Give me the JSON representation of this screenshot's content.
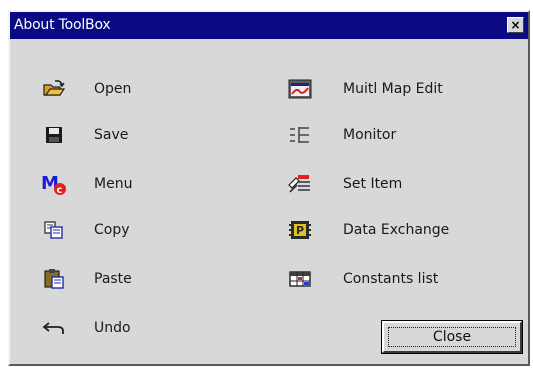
{
  "window": {
    "title": "About ToolBox",
    "close_glyph": "×"
  },
  "left_column": [
    {
      "label": "Open",
      "icon": "open-folder-icon"
    },
    {
      "label": "Save",
      "icon": "floppy-disk-icon"
    },
    {
      "label": "Menu",
      "icon": "menu-mc-icon"
    },
    {
      "label": "Copy",
      "icon": "copy-icon"
    },
    {
      "label": "Paste",
      "icon": "paste-clipboard-icon"
    },
    {
      "label": "Undo",
      "icon": "undo-arrow-icon"
    }
  ],
  "right_column": [
    {
      "label": "Muitl Map Edit",
      "icon": "multi-map-edit-icon"
    },
    {
      "label": "Monitor",
      "icon": "monitor-list-icon"
    },
    {
      "label": "Set Item",
      "icon": "set-item-icon"
    },
    {
      "label": "Data Exchange",
      "icon": "data-exchange-icon"
    },
    {
      "label": "Constants list",
      "icon": "constants-table-icon"
    }
  ],
  "close_button": {
    "label": "Close"
  },
  "colors": {
    "titlebar": "#0a0a84",
    "window_bg": "#d8d8d8"
  }
}
